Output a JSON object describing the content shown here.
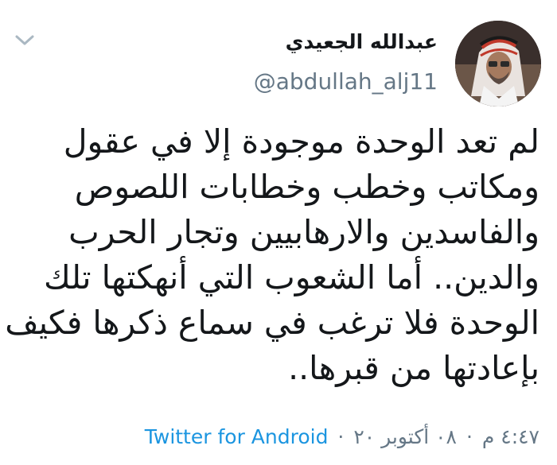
{
  "user": {
    "display_name": "عبدالله الجعيدي",
    "handle": "@abdullah_alj11"
  },
  "icons": {
    "menu": "chevron-down-icon",
    "avatar": "avatar"
  },
  "tweet": {
    "lines": [
      "لم تعد الوحدة موجودة إلا في عقول",
      "ومكاتب وخطب وخطابات اللصوص",
      "والفاسدين والارهابيين وتجار الحرب",
      "والدين.. أما الشعوب التي أنهكتها تلك",
      "الوحدة فلا ترغب في سماع ذكرها فكيف",
      "بإعادتها من قبرها.."
    ]
  },
  "meta": {
    "time": "٤:٤٧ م",
    "separator": "·",
    "date": "٠٨ أكتوبر ٢٠",
    "source": "Twitter for Android"
  },
  "colors": {
    "text": "#14171a",
    "secondary": "#657786",
    "link": "#1b95e0",
    "chevron": "#aab8c2"
  }
}
